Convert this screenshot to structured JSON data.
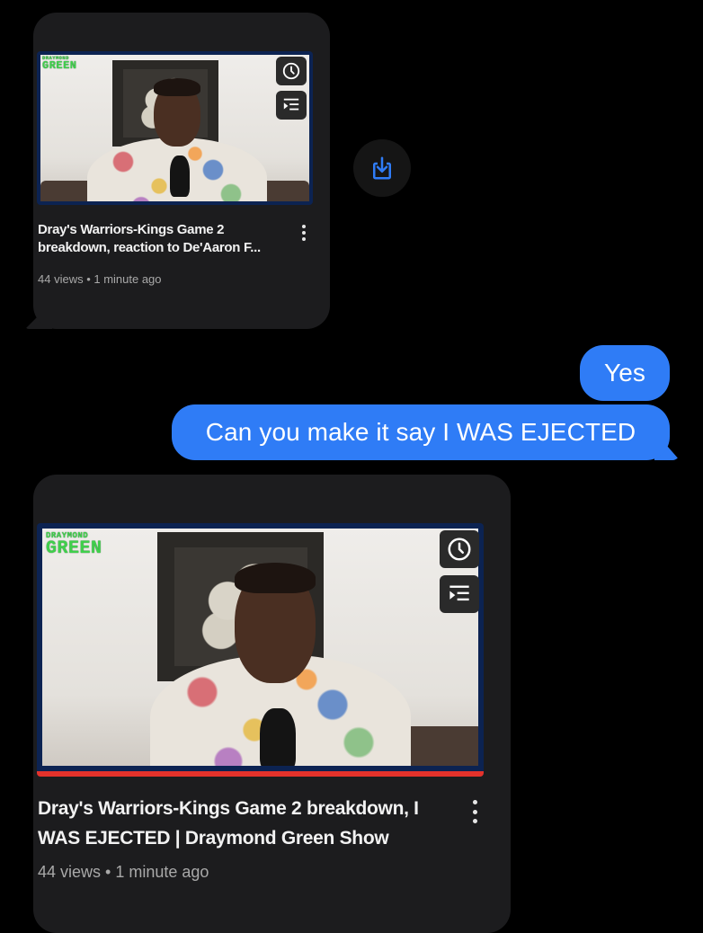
{
  "colors": {
    "background": "#000000",
    "card": "#1c1c1e",
    "sent_bubble": "#2f7cf6",
    "progress_bar": "#e3322b",
    "save_icon": "#2f7cf6"
  },
  "received_1": {
    "thumbnail_logo_top": "DRAYMOND",
    "thumbnail_logo_main": "GREEN",
    "title": "Dray's Warriors-Kings Game 2 breakdown, reaction to De'Aaron F...",
    "meta": "44 views • 1 minute ago",
    "icons": [
      "clock-icon",
      "add-to-queue-icon",
      "more-options-icon"
    ]
  },
  "save_button": {
    "icon": "save-download-icon"
  },
  "sent_messages": [
    {
      "text": "Yes"
    },
    {
      "text": "Can you make it say I WAS EJECTED"
    }
  ],
  "received_2": {
    "thumbnail_logo_top": "DRAYMOND",
    "thumbnail_logo_main": "GREEN",
    "title": "Dray's Warriors-Kings Game 2 breakdown, I WAS EJECTED | Draymond Green Show",
    "meta": "44 views • 1 minute ago",
    "progress": 1.0,
    "icons": [
      "clock-icon",
      "add-to-queue-icon",
      "more-options-icon"
    ]
  }
}
